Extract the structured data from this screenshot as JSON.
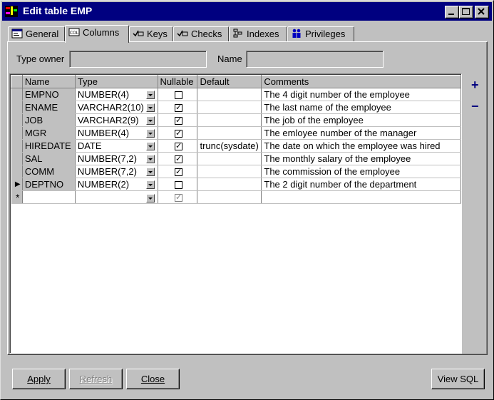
{
  "window": {
    "title": "Edit table EMP",
    "controls": [
      "minimize",
      "maximize",
      "close"
    ]
  },
  "tabs": [
    {
      "label": "General",
      "icon": "general-icon",
      "active": false
    },
    {
      "label": "Columns",
      "icon": "columns-icon",
      "active": true
    },
    {
      "label": "Keys",
      "icon": "keys-icon",
      "active": false
    },
    {
      "label": "Checks",
      "icon": "checks-icon",
      "active": false
    },
    {
      "label": "Indexes",
      "icon": "indexes-icon",
      "active": false
    },
    {
      "label": "Privileges",
      "icon": "privileges-icon",
      "active": false
    }
  ],
  "fields": {
    "type_owner_label": "Type owner",
    "type_owner_value": "",
    "name_label": "Name",
    "name_value": ""
  },
  "grid": {
    "headers": [
      "Name",
      "Type",
      "Nullable",
      "Default",
      "Comments"
    ],
    "rows": [
      {
        "name": "EMPNO",
        "type": "NUMBER(4)",
        "nullable": false,
        "default": "",
        "comments": "The 4 digit number of the employee"
      },
      {
        "name": "ENAME",
        "type": "VARCHAR2(10)",
        "nullable": true,
        "default": "",
        "comments": "The last name of the employee"
      },
      {
        "name": "JOB",
        "type": "VARCHAR2(9)",
        "nullable": true,
        "default": "",
        "comments": "The job of the employee"
      },
      {
        "name": "MGR",
        "type": "NUMBER(4)",
        "nullable": true,
        "default": "",
        "comments": "The emloyee number of the manager"
      },
      {
        "name": "HIREDATE",
        "type": "DATE",
        "nullable": true,
        "default": "trunc(sysdate)",
        "comments": "The date on which the employee was hired"
      },
      {
        "name": "SAL",
        "type": "NUMBER(7,2)",
        "nullable": true,
        "default": "",
        "comments": "The monthly salary of the employee"
      },
      {
        "name": "COMM",
        "type": "NUMBER(7,2)",
        "nullable": true,
        "default": "",
        "comments": "The commission of the employee"
      },
      {
        "name": "DEPTNO",
        "type": "NUMBER(2)",
        "nullable": false,
        "default": "",
        "comments": "The 2 digit number of the department"
      }
    ],
    "current_row_marker": "▶",
    "new_row_marker": "*",
    "new_row_nullable": true
  },
  "side_buttons": {
    "add": "+",
    "remove": "−"
  },
  "buttons": {
    "apply": {
      "label": "Apply",
      "enabled": true
    },
    "refresh": {
      "label": "Refresh",
      "enabled": false
    },
    "close": {
      "label": "Close",
      "enabled": true
    },
    "view_sql": {
      "label": "View SQL",
      "enabled": true
    }
  },
  "colors": {
    "title_bar": "#000080",
    "face": "#c0c0c0",
    "accent": "#000080"
  }
}
